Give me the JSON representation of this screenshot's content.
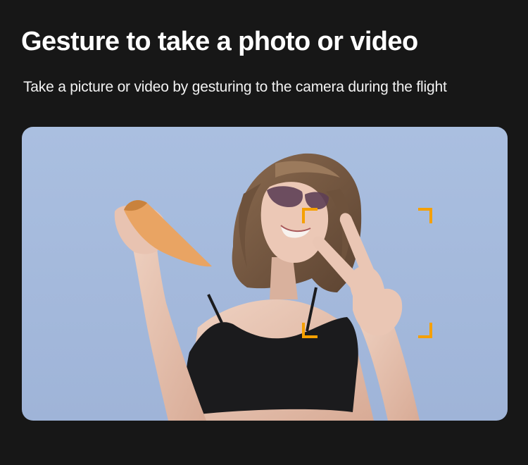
{
  "header": {
    "title": "Gesture to take a photo or video",
    "subtitle": "Take a picture or video by gesturing to the camera during the flight"
  },
  "photo": {
    "subject": "woman-holding-pizza-making-peace-sign",
    "focus_frame_color": "#f5a000"
  },
  "colors": {
    "background": "#171717",
    "sky": "#a9bcdc",
    "accent": "#f5a000"
  }
}
